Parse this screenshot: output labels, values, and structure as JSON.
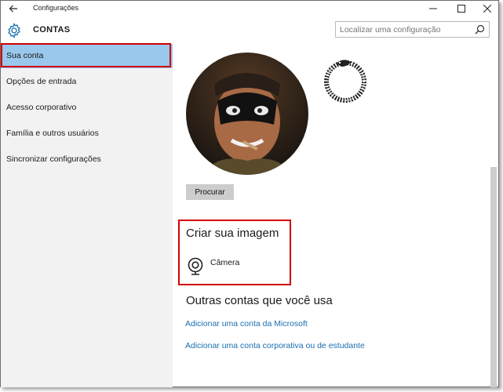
{
  "window": {
    "title": "Configurações"
  },
  "header": {
    "title": "CONTAS",
    "search_placeholder": "Localizar uma configuração"
  },
  "sidebar": {
    "items": [
      {
        "label": "Sua conta",
        "active": true
      },
      {
        "label": "Opções de entrada",
        "active": false
      },
      {
        "label": "Acesso corporativo",
        "active": false
      },
      {
        "label": "Família e outros usuários",
        "active": false
      },
      {
        "label": "Sincronizar configurações",
        "active": false
      }
    ]
  },
  "main": {
    "browse_label": "Procurar",
    "create_title": "Criar sua imagem",
    "camera_label": "Câmera",
    "other_accounts_title": "Outras contas que você usa",
    "links": {
      "add_microsoft": "Adicionar uma conta da Microsoft",
      "add_work": "Adicionar uma conta corporativa ou de estudante"
    }
  },
  "icons": [
    "back-arrow-icon",
    "minimize-icon",
    "maximize-icon",
    "close-icon",
    "gear-icon",
    "search-icon",
    "camera-icon"
  ],
  "colors": {
    "active_nav": "#99c8ec",
    "highlight_border": "#d20000",
    "link": "#1a6fb0",
    "sidebar_bg": "#f2f2f2",
    "button_bg": "#cccccc"
  }
}
